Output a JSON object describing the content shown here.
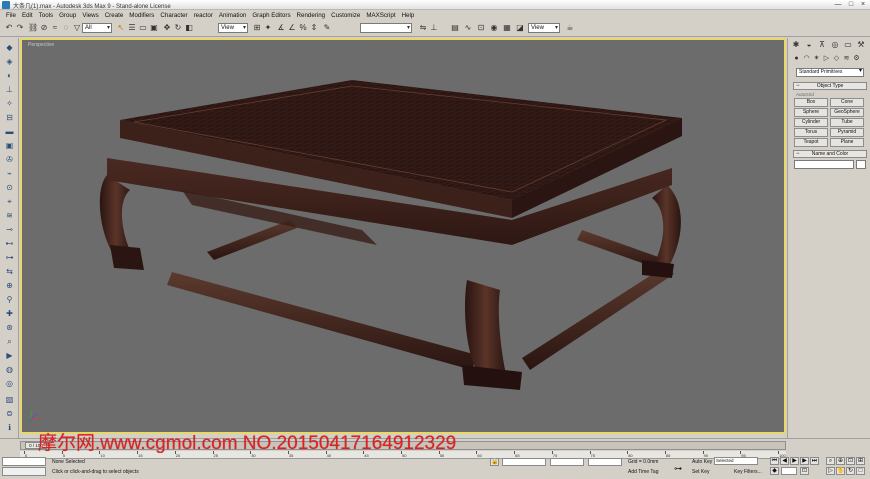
{
  "window": {
    "title": "大条几(1).max - Autodesk 3ds Max 9 - Stand-alone License",
    "minimize": "—",
    "maximize": "□",
    "close": "×"
  },
  "menu": [
    "File",
    "Edit",
    "Tools",
    "Group",
    "Views",
    "Create",
    "Modifiers",
    "Character",
    "reactor",
    "Animation",
    "Graph Editors",
    "Rendering",
    "Customize",
    "MAXScript",
    "Help"
  ],
  "toolbar": {
    "selection_filter": "All",
    "reference_coord": "View",
    "named_selection": "",
    "render_view": "View"
  },
  "viewport": {
    "label": "Perspective",
    "background": "#6c6c6c",
    "border_color": "#e8d86a"
  },
  "command_panel": {
    "category_dropdown": "Standard Primitives",
    "object_type_title": "Object Type",
    "autogrid_label": "AutoGrid",
    "buttons": [
      "Box",
      "Cone",
      "Sphere",
      "GeoSphere",
      "Cylinder",
      "Tube",
      "Torus",
      "Pyramid",
      "Teapot",
      "Plane"
    ],
    "name_color_title": "Name and Color",
    "name_value": ""
  },
  "timeline": {
    "slider_label": "0 / 100",
    "ticks": [
      "0",
      "5",
      "10",
      "15",
      "20",
      "25",
      "30",
      "35",
      "40",
      "45",
      "50",
      "55",
      "60",
      "65",
      "70",
      "75",
      "80",
      "85",
      "90",
      "95",
      "100"
    ]
  },
  "status": {
    "selection_status": "None Selected",
    "prompt": "Click or click-and-drag to select objects",
    "grid": "Grid = 0.0mm",
    "add_time_tag": "Add Time Tag",
    "auto_key": "Auto Key",
    "set_key": "Set Key",
    "selected": "Selected",
    "key_filters": "Key Filters..."
  },
  "watermark": "摩尔网.www.cgmol.com NO.20150417164912329",
  "colors": {
    "accent_viewport_border": "#e8d86a",
    "watermark": "#e02020",
    "table_wood": "#3a1d18"
  }
}
